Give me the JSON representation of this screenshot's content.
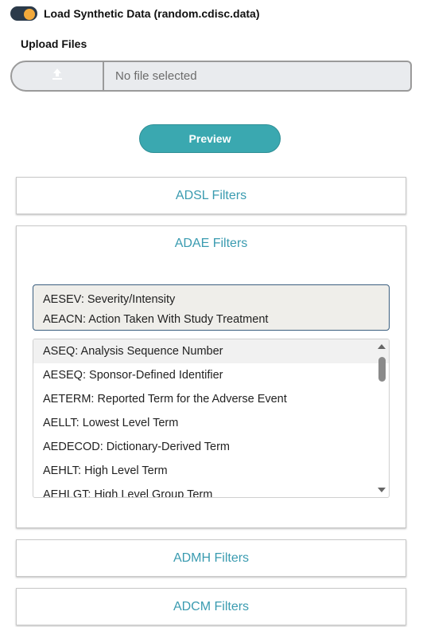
{
  "toggle": {
    "label": "Load Synthetic Data (random.cdisc.data)",
    "state": "on",
    "knob_color": "#f2a93b"
  },
  "upload": {
    "title": "Upload Files",
    "icon": "upload-icon",
    "placeholder": "No file selected"
  },
  "preview": {
    "label": "Preview",
    "color": "#3aa8b0"
  },
  "panels": {
    "adsl": {
      "title": "ADSL Filters"
    },
    "adae": {
      "title": "ADAE Filters",
      "selected": [
        "AESEV: Severity/Intensity",
        "AEACN: Action Taken With Study Treatment"
      ],
      "options": [
        "ASEQ: Analysis Sequence Number",
        "AESEQ: Sponsor-Defined Identifier",
        "AETERM: Reported Term for the Adverse Event",
        "AELLT: Lowest Level Term",
        "AEDECOD: Dictionary-Derived Term",
        "AEHLT: High Level Term",
        "AEHLGT: High Level Group Term"
      ]
    },
    "admh": {
      "title": "ADMH Filters"
    },
    "adcm": {
      "title": "ADCM Filters"
    }
  }
}
